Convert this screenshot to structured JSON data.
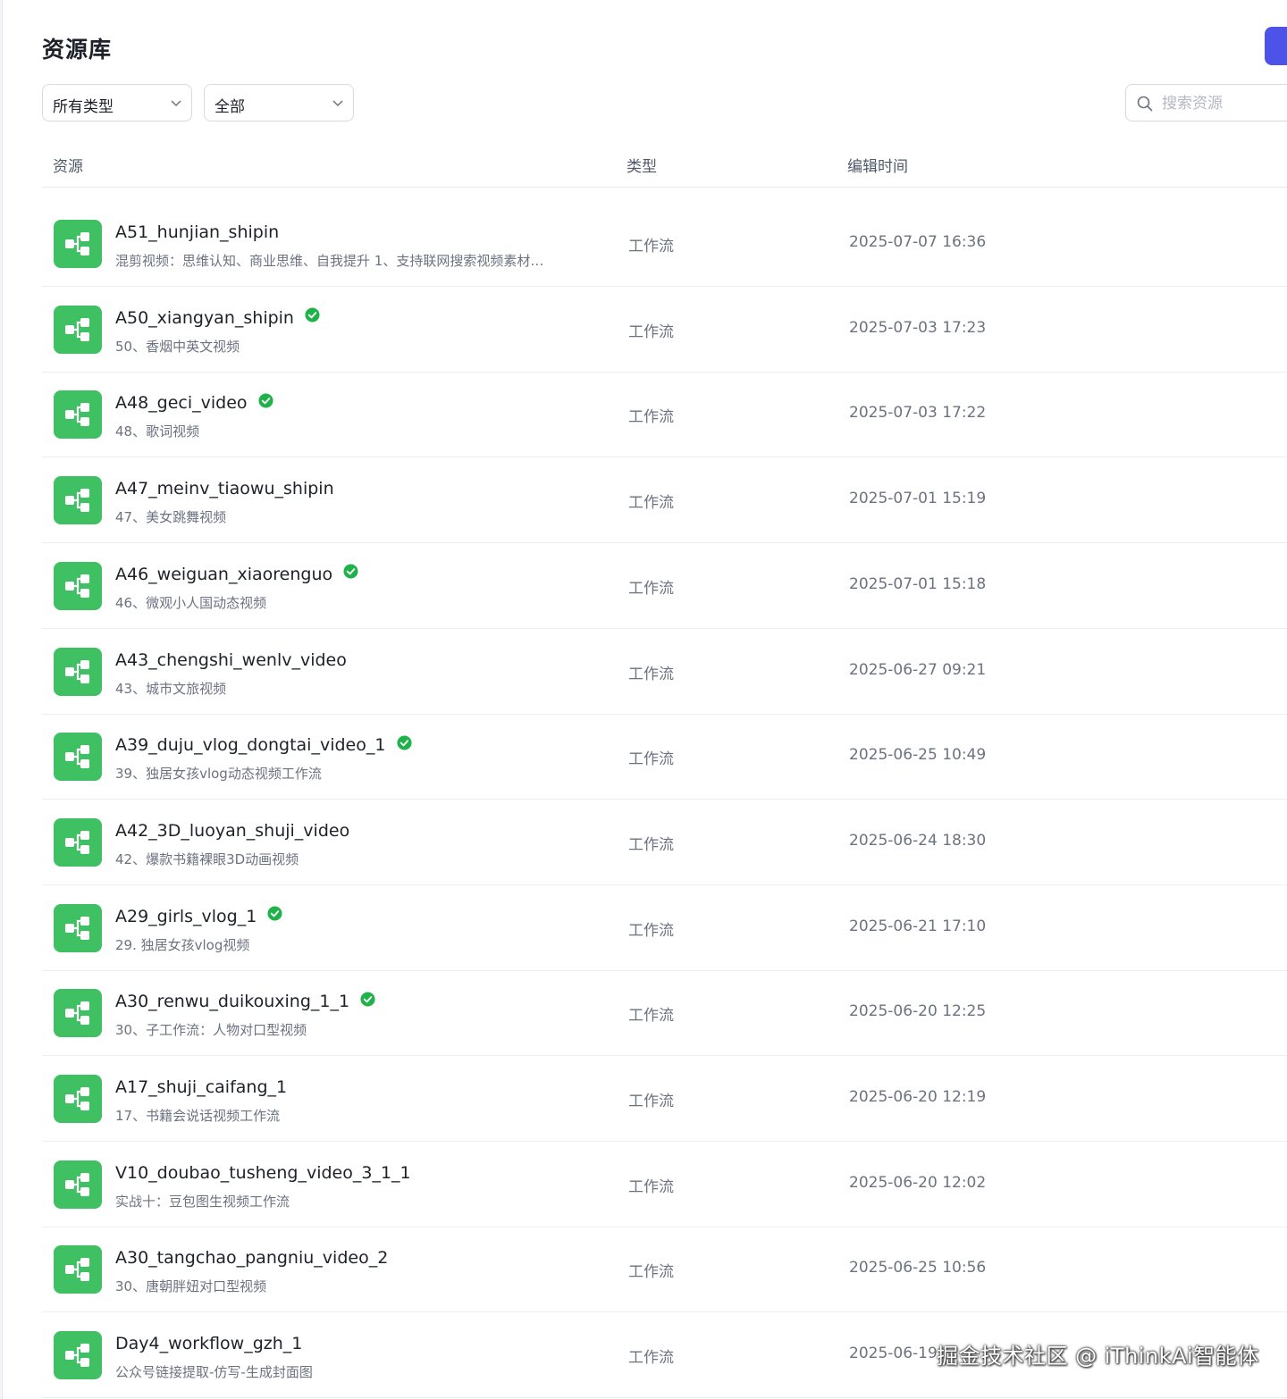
{
  "page": {
    "title": "资源库"
  },
  "filters": {
    "type_select": "所有类型",
    "scope_select": "全部"
  },
  "search": {
    "placeholder": "搜索资源"
  },
  "table": {
    "headers": {
      "resource": "资源",
      "type": "类型",
      "edited": "编辑时间"
    },
    "rows": [
      {
        "name": "A51_hunjian_shipin",
        "desc": "混剪视频：思维认知、商业思维、自我提升 1、支持联网搜索视频素材…",
        "type": "工作流",
        "time": "2025-07-07 16:36",
        "verified": false
      },
      {
        "name": "A50_xiangyan_shipin",
        "desc": "50、香烟中英文视频",
        "type": "工作流",
        "time": "2025-07-03 17:23",
        "verified": true
      },
      {
        "name": "A48_geci_video",
        "desc": "48、歌词视频",
        "type": "工作流",
        "time": "2025-07-03 17:22",
        "verified": true
      },
      {
        "name": "A47_meinv_tiaowu_shipin",
        "desc": "47、美女跳舞视频",
        "type": "工作流",
        "time": "2025-07-01 15:19",
        "verified": false
      },
      {
        "name": "A46_weiguan_xiaorenguo",
        "desc": "46、微观小人国动态视频",
        "type": "工作流",
        "time": "2025-07-01 15:18",
        "verified": true
      },
      {
        "name": "A43_chengshi_wenlv_video",
        "desc": "43、城市文旅视频",
        "type": "工作流",
        "time": "2025-06-27 09:21",
        "verified": false
      },
      {
        "name": "A39_duju_vlog_dongtai_video_1",
        "desc": "39、独居女孩vlog动态视频工作流",
        "type": "工作流",
        "time": "2025-06-25 10:49",
        "verified": true
      },
      {
        "name": "A42_3D_luoyan_shuji_video",
        "desc": "42、爆款书籍裸眼3D动画视频",
        "type": "工作流",
        "time": "2025-06-24 18:30",
        "verified": false
      },
      {
        "name": "A29_girls_vlog_1",
        "desc": "29. 独居女孩vlog视频",
        "type": "工作流",
        "time": "2025-06-21 17:10",
        "verified": true
      },
      {
        "name": "A30_renwu_duikouxing_1_1",
        "desc": "30、子工作流：人物对口型视频",
        "type": "工作流",
        "time": "2025-06-20 12:25",
        "verified": true
      },
      {
        "name": "A17_shuji_caifang_1",
        "desc": "17、书籍会说话视频工作流",
        "type": "工作流",
        "time": "2025-06-20 12:19",
        "verified": false
      },
      {
        "name": "V10_doubao_tusheng_video_3_1_1",
        "desc": "实战十：豆包图生视频工作流",
        "type": "工作流",
        "time": "2025-06-20 12:02",
        "verified": false
      },
      {
        "name": "A30_tangchao_pangniu_video_2",
        "desc": "30、唐朝胖妞对口型视频",
        "type": "工作流",
        "time": "2025-06-25 10:56",
        "verified": false
      },
      {
        "name": "Day4_workflow_gzh_1",
        "desc": "公众号链接提取-仿写-生成封面图",
        "type": "工作流",
        "time": "2025-06-19",
        "verified": false
      }
    ]
  },
  "watermark": "掘金技术社区 @ iThinkAi智能体",
  "colors": {
    "accent": "#4d53e8",
    "workflow_icon_bg": "#3ec063",
    "verified": "#1fb24b"
  },
  "icons": {
    "row_icon": "workflow-icon",
    "verified": "verified-check-icon",
    "search": "search-icon",
    "dropdown": "chevron-down-icon"
  }
}
